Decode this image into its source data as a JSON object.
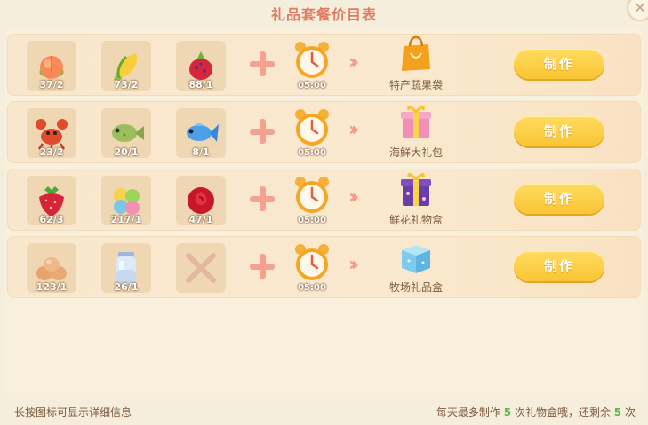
{
  "title": "礼品套餐价目表",
  "close_icon": "close-icon",
  "rows": [
    {
      "ingredients": [
        {
          "icon": "peach-icon",
          "count": "37/2"
        },
        {
          "icon": "corn-icon",
          "count": "73/2"
        },
        {
          "icon": "dragon-fruit-icon",
          "count": "88/1"
        }
      ],
      "time": "05:00",
      "product": "特产蔬果袋",
      "product_icon": "shopping-bag-icon",
      "button": "制作"
    },
    {
      "ingredients": [
        {
          "icon": "lobster-icon",
          "count": "23/2"
        },
        {
          "icon": "fish-green-icon",
          "count": "20/1"
        },
        {
          "icon": "fish-blue-icon",
          "count": "8/1"
        }
      ],
      "time": "05:00",
      "product": "海鲜大礼包",
      "product_icon": "gift-box-pink-icon",
      "button": "制作"
    },
    {
      "ingredients": [
        {
          "icon": "strawberry-icon",
          "count": "62/3"
        },
        {
          "icon": "flower-cluster-icon",
          "count": "217/1"
        },
        {
          "icon": "rose-icon",
          "count": "47/1"
        }
      ],
      "time": "05:00",
      "product": "鲜花礼物盒",
      "product_icon": "gift-box-purple-icon",
      "button": "制作"
    },
    {
      "ingredients": [
        {
          "icon": "eggs-icon",
          "count": "123/1"
        },
        {
          "icon": "milk-jar-icon",
          "count": "26/1"
        },
        {
          "icon": "empty-slot-icon",
          "count": ""
        }
      ],
      "time": "05:00",
      "product": "牧场礼品盒",
      "product_icon": "gift-box-blue-icon",
      "button": "制作"
    }
  ],
  "footer": {
    "hint": "长按图标可显示详细信息",
    "limit_prefix": "每天最多制作",
    "limit_total": "5",
    "limit_middle": "次礼物盒哦，还剩余",
    "limit_remaining": "5",
    "limit_suffix": "次"
  }
}
